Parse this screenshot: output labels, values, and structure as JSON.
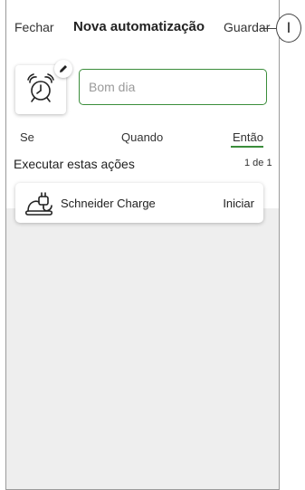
{
  "header": {
    "close_label": "Fechar",
    "title": "Nova automatização",
    "save_label": "Guardar"
  },
  "callout": {
    "label": "I"
  },
  "automation": {
    "icon": "alarm-clock-icon",
    "name_placeholder": "Bom dia",
    "name_value": ""
  },
  "tabs": [
    {
      "label": "Se",
      "active": false
    },
    {
      "label": "Quando",
      "active": false
    },
    {
      "label": "Então",
      "active": true
    }
  ],
  "actions_section": {
    "title": "Executar estas ações",
    "count": "1 de 1",
    "items": [
      {
        "icon": "ev-charger-icon",
        "label": "Schneider Charge",
        "value": "Iniciar"
      }
    ]
  },
  "colors": {
    "accent": "#3b8d3b",
    "background_grey": "#eeeeee"
  }
}
